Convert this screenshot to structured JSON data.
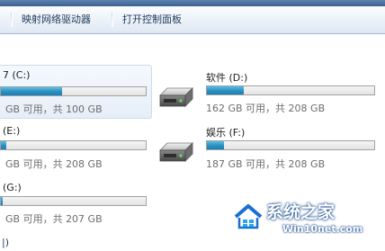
{
  "toolbar": {
    "map_drive_label": "映射网络驱动器",
    "open_control_panel_label": "打开控制面板"
  },
  "drives": [
    {
      "name": "7 (C:)",
      "free_text": "GB 可用，共 100 GB",
      "used_fraction": 0.42,
      "selected": true
    },
    {
      "name": "软件 (D:)",
      "free_text": "162 GB 可用，共 208 GB",
      "used_fraction": 0.22
    },
    {
      "name": "(E:)",
      "free_text": "GB 可用，共 208 GB",
      "used_fraction": 0.04
    },
    {
      "name": "娱乐 (F:)",
      "free_text": "187 GB 可用，共 208 GB",
      "used_fraction": 0.1
    },
    {
      "name": "(G:)",
      "free_text": "GB 可用，共 207 GB",
      "used_fraction": 0.01
    }
  ],
  "section_fragment": "|)",
  "watermark": {
    "title": "系统之家",
    "url": "Win10net.com"
  },
  "colors": {
    "bar_fill": "#2a8fc2",
    "toolbar_text": "#1e395b",
    "free_text": "#6d6d6d"
  }
}
